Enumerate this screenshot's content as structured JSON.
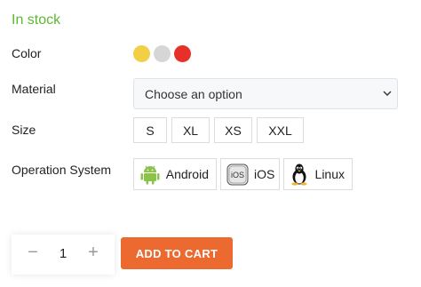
{
  "stock": {
    "label": "In stock",
    "color": "#5cb82f"
  },
  "color": {
    "label": "Color",
    "swatches": [
      {
        "name": "yellow",
        "hex": "#f2cf44"
      },
      {
        "name": "gray",
        "hex": "#d6d6d6"
      },
      {
        "name": "red",
        "hex": "#e8302a"
      }
    ]
  },
  "material": {
    "label": "Material",
    "placeholder": "Choose an option",
    "icon": "chevron-down-icon"
  },
  "size": {
    "label": "Size",
    "options": [
      "S",
      "XL",
      "XS",
      "XXL"
    ]
  },
  "os": {
    "label": "Operation System",
    "options": [
      {
        "label": "Android",
        "icon": "android-icon"
      },
      {
        "label": "iOS",
        "icon": "ios-icon"
      },
      {
        "label": "Linux",
        "icon": "linux-icon"
      }
    ]
  },
  "cart": {
    "quantity": "1",
    "minus": "−",
    "plus": "+",
    "button_label": "ADD TO CART",
    "button_color": "#ec6a2f"
  }
}
